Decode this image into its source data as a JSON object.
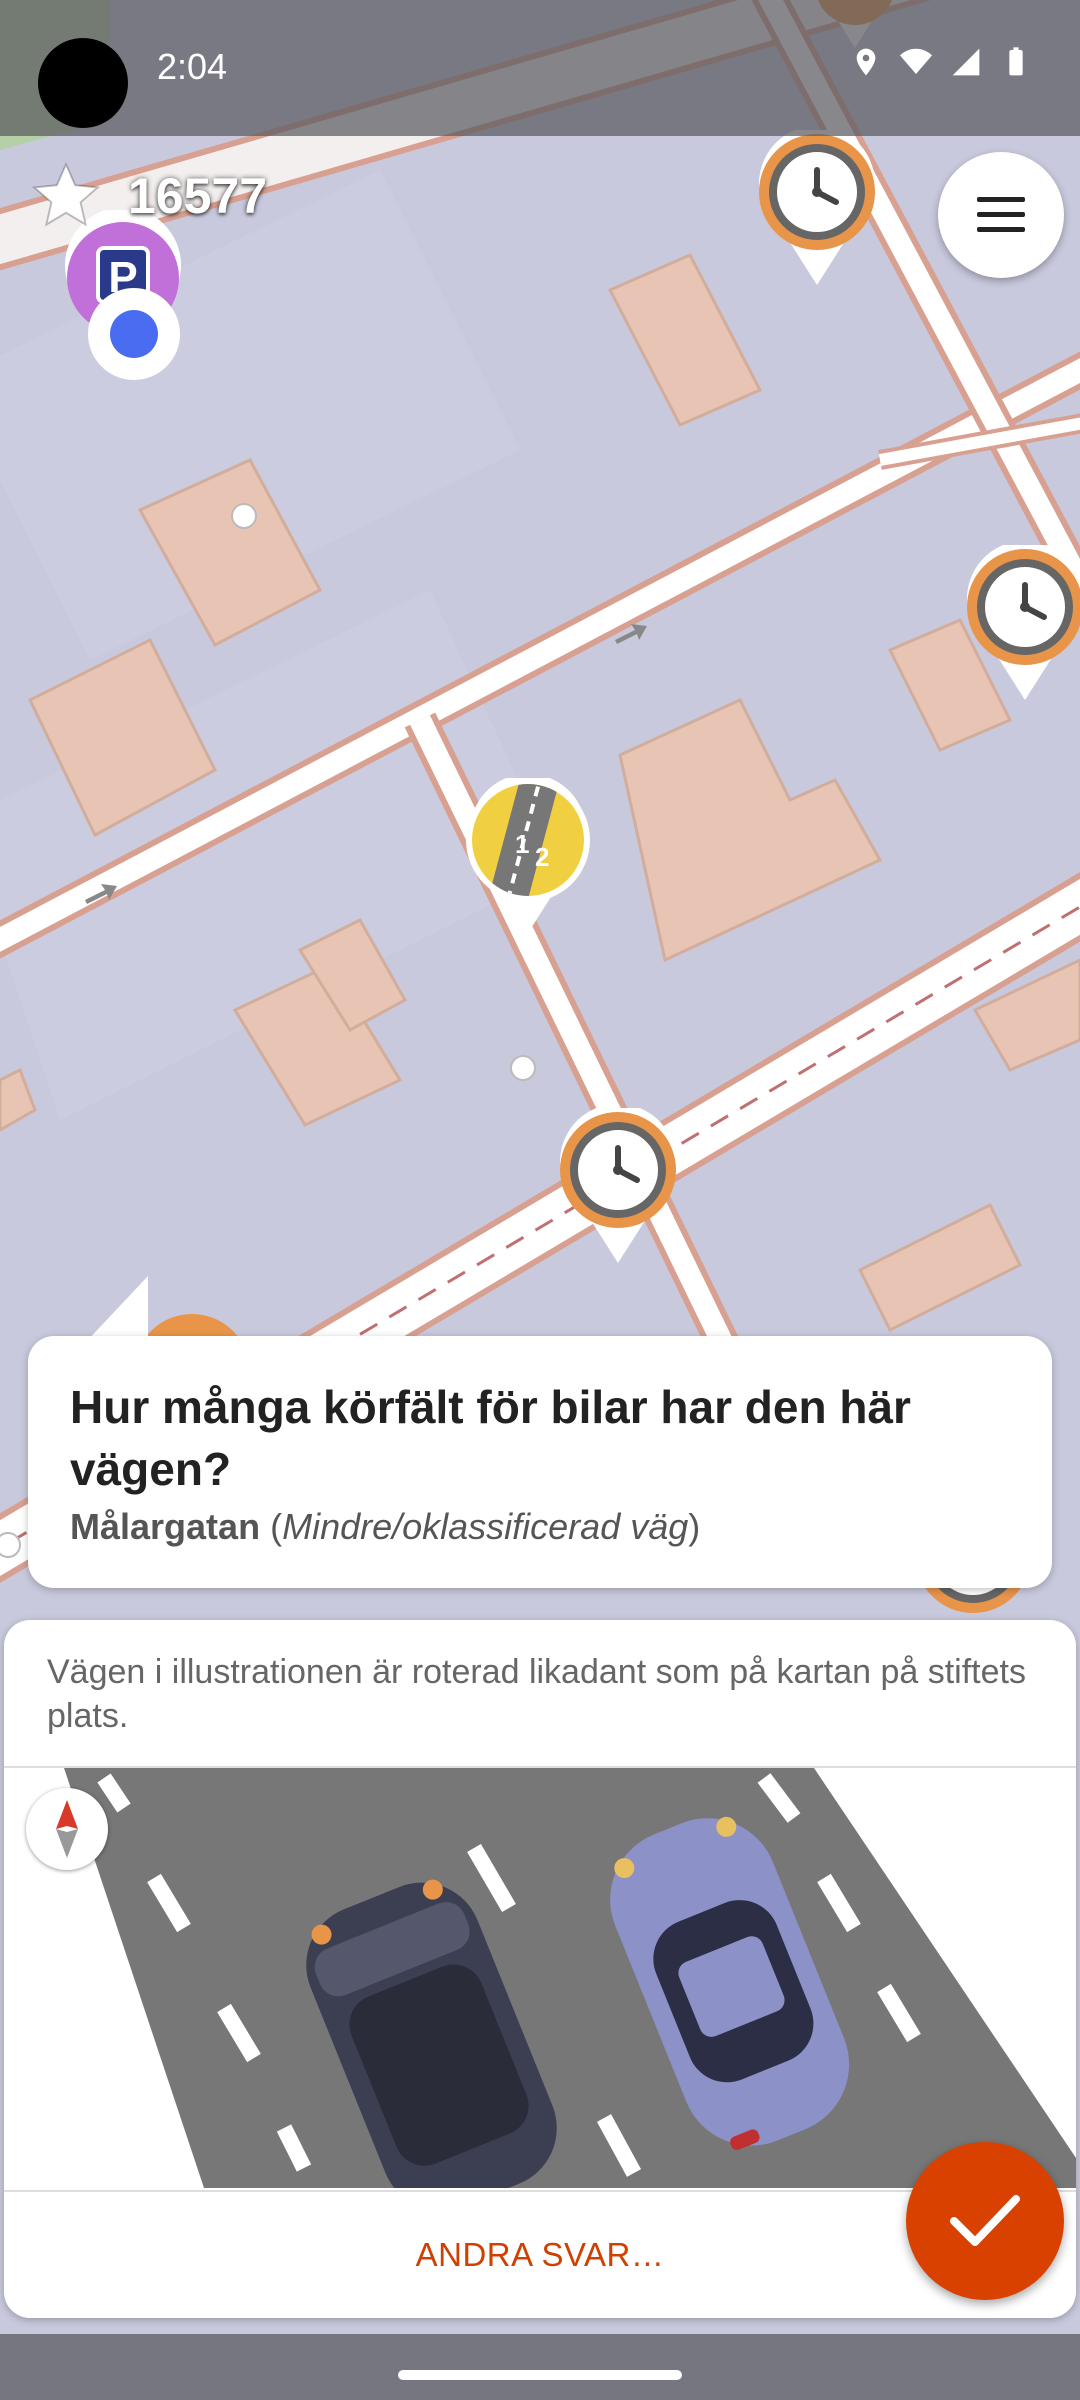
{
  "status_bar": {
    "time": "2:04",
    "icons": [
      "location-icon",
      "wifi-icon",
      "signal-icon",
      "battery-icon"
    ]
  },
  "score": {
    "icon": "star-icon",
    "value": "16577"
  },
  "menu": {
    "icon": "hamburger-menu-icon"
  },
  "map": {
    "pins": [
      "parking-pin",
      "clock-pin",
      "clock-pin",
      "lanes-pin",
      "clock-pin",
      "clock-pin",
      "clock-pin"
    ],
    "location_marker": "current-location-dot"
  },
  "quest": {
    "title": "Hur många körfält för bilar har den här vägen?",
    "road_name": "Målargatan",
    "road_type": "Mindre/oklassificerad väg"
  },
  "answer_panel": {
    "hint": "Vägen i illustrationen är roterad likadant som på kartan på stiftets plats.",
    "compass_icon": "compass-icon",
    "other_answers_label": "ANDRA SVAR…"
  },
  "ok_button": {
    "icon": "checkmark-icon"
  },
  "colors": {
    "map_background": "#c8c9dd",
    "building": "#e8c4b4",
    "road": "#ffffff",
    "road_border": "#d8a090",
    "accent_orange": "#d84100",
    "clock_pin_ring": "#e8954a",
    "parking_pin": "#c070d8",
    "lanes_pin": "#f0d040"
  }
}
